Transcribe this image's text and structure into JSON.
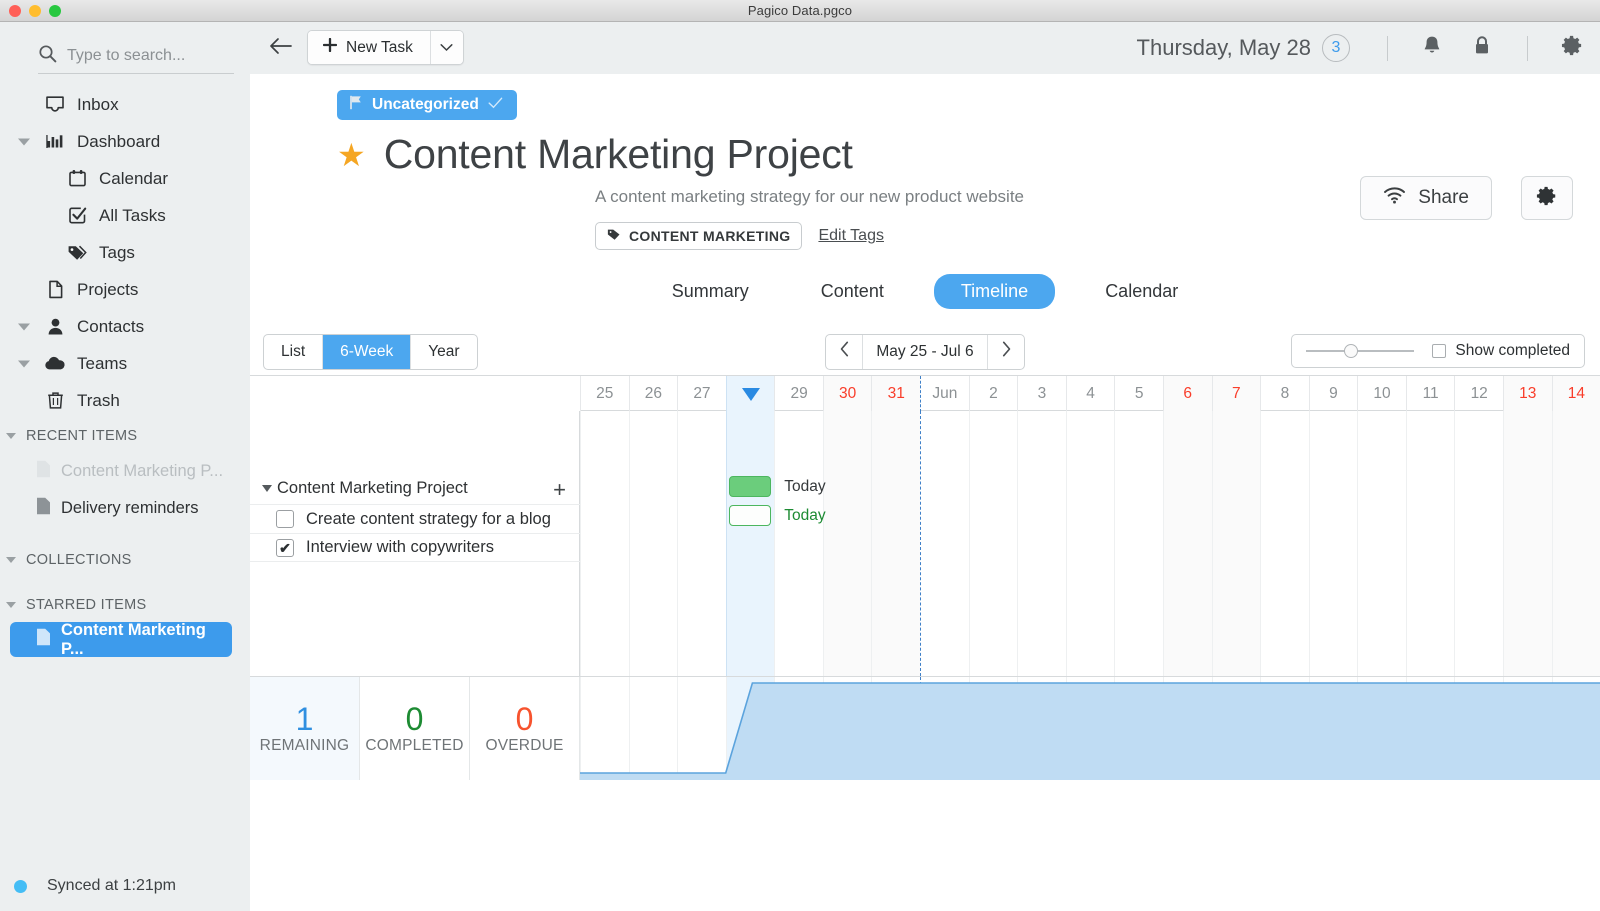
{
  "window": {
    "title": "Pagico Data.pgco"
  },
  "sidebar": {
    "search": {
      "placeholder": "Type to search...",
      "value": ""
    },
    "nav": [
      {
        "label": "Inbox",
        "icon": "inbox-icon",
        "level": 0,
        "caret": false
      },
      {
        "label": "Dashboard",
        "icon": "chart-bars-icon",
        "level": 0,
        "caret": true
      },
      {
        "label": "Calendar",
        "icon": "calendar-icon",
        "level": 1,
        "caret": false
      },
      {
        "label": "All Tasks",
        "icon": "checkbox-checked-icon",
        "level": 1,
        "caret": false
      },
      {
        "label": "Tags",
        "icon": "tags-icon",
        "level": 1,
        "caret": false
      },
      {
        "label": "Projects",
        "icon": "document-icon",
        "level": 0,
        "caret": false
      },
      {
        "label": "Contacts",
        "icon": "person-icon",
        "level": 0,
        "caret": true
      },
      {
        "label": "Teams",
        "icon": "cloud-icon",
        "level": 0,
        "caret": true
      },
      {
        "label": "Trash",
        "icon": "trash-icon",
        "level": 0,
        "caret": false
      }
    ],
    "sections": [
      {
        "title": "RECENT ITEMS",
        "items": [
          {
            "label": "Content Marketing P...",
            "state": "muted"
          },
          {
            "label": "Delivery reminders",
            "state": "normal"
          }
        ]
      },
      {
        "title": "COLLECTIONS",
        "items": []
      },
      {
        "title": "STARRED ITEMS",
        "items": [
          {
            "label": "Content Marketing P...",
            "state": "selected"
          }
        ]
      }
    ],
    "status": {
      "label": "Synced at 1:21pm"
    }
  },
  "toolbar": {
    "back_icon": "arrow-left-icon",
    "new_task_label": "New Task",
    "date_label": "Thursday, May 28",
    "badge_count": "3",
    "icons": [
      "bell-icon",
      "lock-icon",
      "gear-icon"
    ]
  },
  "project": {
    "category": "Uncategorized",
    "title": "Content Marketing Project",
    "description": "A content marketing strategy for our new product website",
    "tag": "CONTENT MARKETING",
    "edit_tags": "Edit Tags",
    "share_label": "Share",
    "starred": true
  },
  "tabs": [
    {
      "label": "Summary",
      "active": false
    },
    {
      "label": "Content",
      "active": false
    },
    {
      "label": "Timeline",
      "active": true
    },
    {
      "label": "Calendar",
      "active": false
    }
  ],
  "view_controls": {
    "segments": [
      {
        "label": "List",
        "active": false
      },
      {
        "label": "6-Week",
        "active": true
      },
      {
        "label": "Year",
        "active": false
      }
    ],
    "prev_icon": "chevron-left-icon",
    "next_icon": "chevron-right-icon",
    "range_label": "May 25 - Jul 6",
    "zoom_slider_value": 35,
    "show_completed_label": "Show completed",
    "show_completed_checked": false
  },
  "gantt": {
    "group": {
      "label": "Content Marketing Project",
      "add_icon": "plus-icon"
    },
    "tasks": [
      {
        "label": "Create content strategy for a blog",
        "checked": false,
        "bar_style": "filled",
        "bar_label": "Today",
        "bar_label_color": "dark",
        "start_col": 3,
        "span": 1
      },
      {
        "label": "Interview with copywriters",
        "checked": true,
        "bar_style": "hollow",
        "bar_label": "Today",
        "bar_label_color": "green",
        "start_col": 3,
        "span": 1
      }
    ],
    "columns": [
      {
        "day": "25",
        "weekday": "Mon",
        "weekend": false,
        "today": false,
        "monthstart": false
      },
      {
        "day": "26",
        "weekday": "Tue",
        "weekend": false,
        "today": false,
        "monthstart": false
      },
      {
        "day": "27",
        "weekday": "Wed",
        "weekend": false,
        "today": false,
        "monthstart": false
      },
      {
        "day": "",
        "weekday": "Thu",
        "weekend": false,
        "today": true,
        "monthstart": false
      },
      {
        "day": "29",
        "weekday": "Fri",
        "weekend": false,
        "today": false,
        "monthstart": false
      },
      {
        "day": "30",
        "weekday": "Sat",
        "weekend": true,
        "today": false,
        "monthstart": false
      },
      {
        "day": "31",
        "weekday": "Sun",
        "weekend": true,
        "today": false,
        "monthstart": false
      },
      {
        "day": "Jun",
        "weekday": "Mon",
        "weekend": false,
        "today": false,
        "monthstart": true
      },
      {
        "day": "2",
        "weekday": "Tue",
        "weekend": false,
        "today": false,
        "monthstart": false
      },
      {
        "day": "3",
        "weekday": "Wed",
        "weekend": false,
        "today": false,
        "monthstart": false
      },
      {
        "day": "4",
        "weekday": "Thu",
        "weekend": false,
        "today": false,
        "monthstart": false
      },
      {
        "day": "5",
        "weekday": "Fri",
        "weekend": false,
        "today": false,
        "monthstart": false
      },
      {
        "day": "6",
        "weekday": "Sat",
        "weekend": true,
        "today": false,
        "monthstart": false
      },
      {
        "day": "7",
        "weekday": "Sun",
        "weekend": true,
        "today": false,
        "monthstart": false
      },
      {
        "day": "8",
        "weekday": "Mon",
        "weekend": false,
        "today": false,
        "monthstart": false
      },
      {
        "day": "9",
        "weekday": "Tue",
        "weekend": false,
        "today": false,
        "monthstart": false
      },
      {
        "day": "10",
        "weekday": "Wed",
        "weekend": false,
        "today": false,
        "monthstart": false
      },
      {
        "day": "11",
        "weekday": "Thu",
        "weekend": false,
        "today": false,
        "monthstart": false
      },
      {
        "day": "12",
        "weekday": "Fri",
        "weekend": false,
        "today": false,
        "monthstart": false
      },
      {
        "day": "13",
        "weekday": "Sat",
        "weekend": true,
        "today": false,
        "monthstart": false
      },
      {
        "day": "14",
        "weekday": "Sun",
        "weekend": true,
        "today": false,
        "monthstart": false
      }
    ]
  },
  "stats": [
    {
      "value": "1",
      "label": "REMAINING",
      "color": "#2f8fe0",
      "highlight": true
    },
    {
      "value": "0",
      "label": "COMPLETED",
      "color": "#1d8b33",
      "highlight": false
    },
    {
      "value": "0",
      "label": "OVERDUE",
      "color": "#f7532e",
      "highlight": false
    }
  ],
  "chart_data": {
    "type": "area",
    "title": "Workload",
    "x": [
      "25",
      "26",
      "27",
      "28",
      "29",
      "30",
      "31",
      "Jun",
      "2",
      "3",
      "4",
      "5",
      "6",
      "7",
      "8",
      "9",
      "10",
      "11",
      "12",
      "13",
      "14"
    ],
    "values": [
      0,
      0,
      0,
      1,
      1,
      1,
      1,
      1,
      1,
      1,
      1,
      1,
      1,
      1,
      1,
      1,
      1,
      1,
      1,
      1,
      1
    ],
    "ylim": [
      0,
      1
    ],
    "fill_color": "#bfdcf3",
    "line_color": "#5ba3dd",
    "baseline_color": "#b0322a",
    "grid": true,
    "legend": "none"
  }
}
